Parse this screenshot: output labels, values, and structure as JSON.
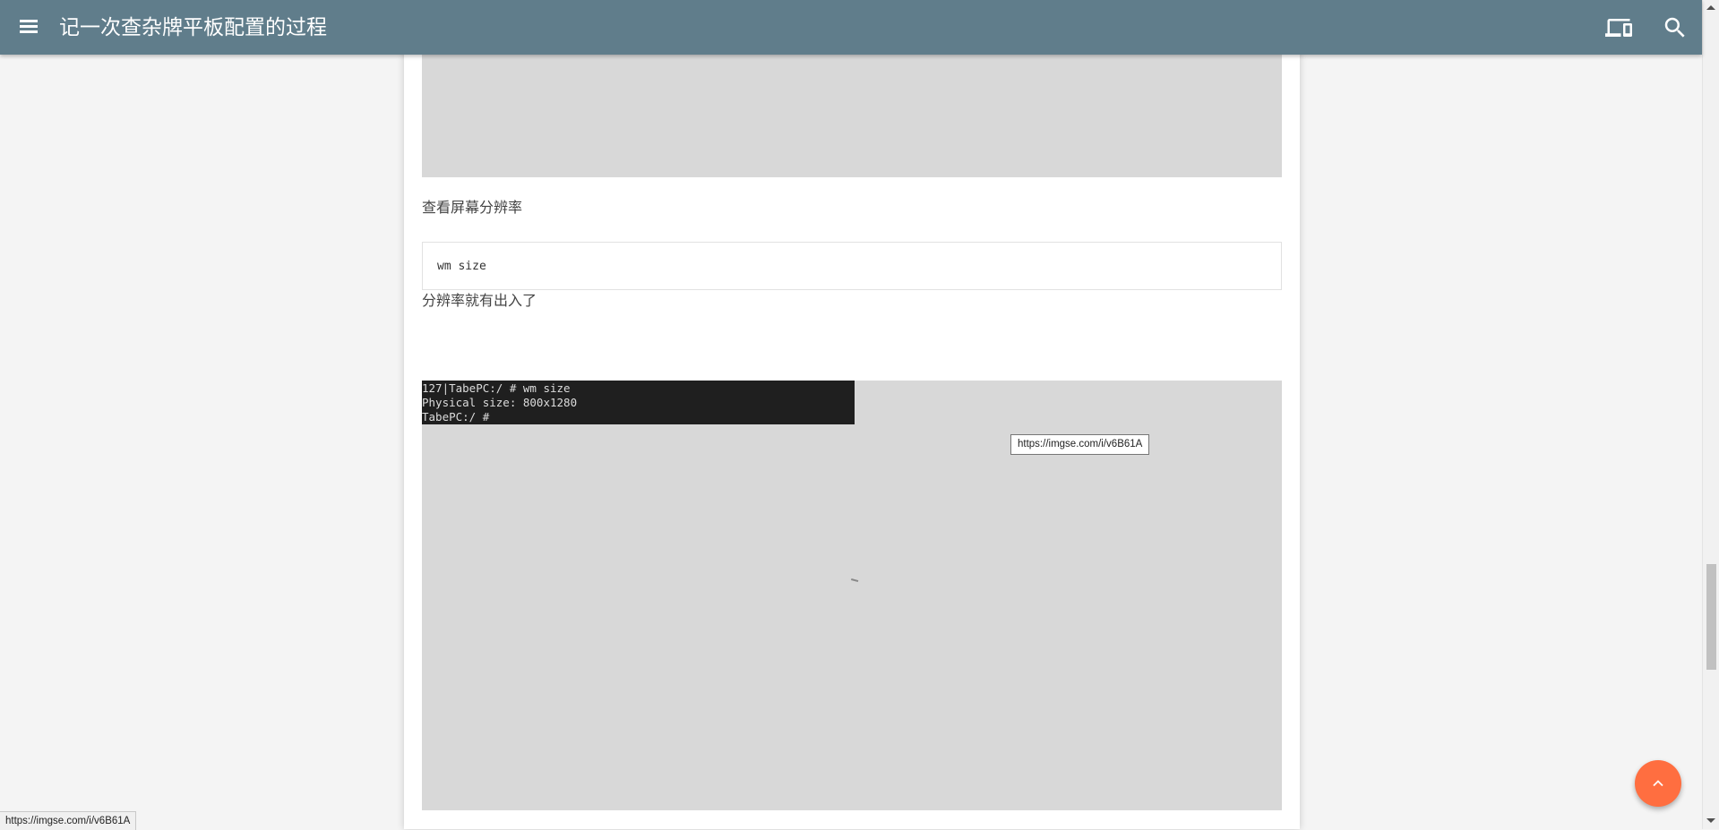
{
  "appbar": {
    "title": "记一次查杂牌平板配置的过程",
    "menu_icon": "menu-icon",
    "devices_icon": "devices-icon",
    "search_icon": "search-icon"
  },
  "article": {
    "para_resolution": "查看屏幕分辨率",
    "code_wm_size": "wm size",
    "para_mismatch": "分辨率就有出入了",
    "terminal_lines": [
      "127|TabePC:/ # wm size",
      "Physical size: 800x1280",
      "TabePC:/ #"
    ],
    "image_tooltip": "https://imgse.com/i/v6B61A"
  },
  "fab": {
    "icon": "chevron-up-icon"
  },
  "status_bar": {
    "url": "https://imgse.com/i/v6B61A"
  },
  "colors": {
    "appbar": "#607d8b",
    "fab": "#ff6e40",
    "page_bg": "#f4f4f4",
    "image_placeholder": "#d8d8d8"
  }
}
